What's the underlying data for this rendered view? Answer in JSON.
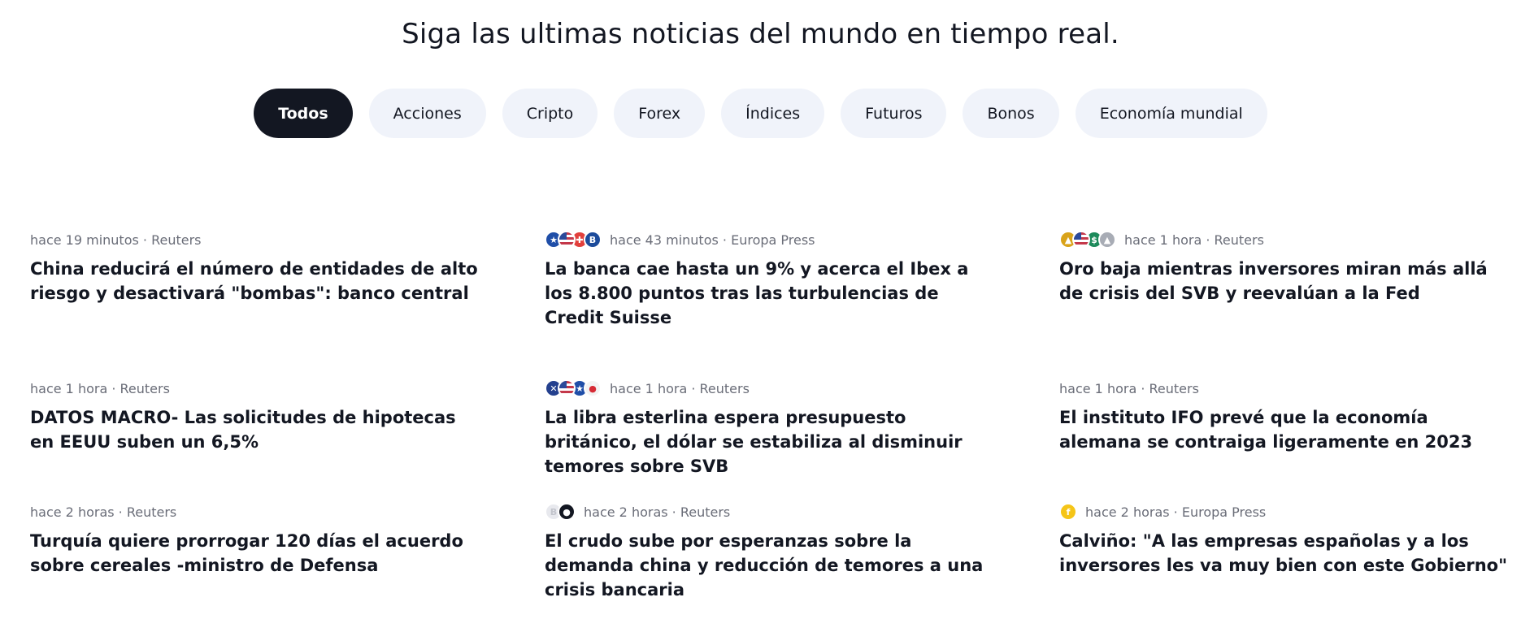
{
  "header": {
    "title": "Siga las ultimas noticias del mundo en tiempo real."
  },
  "tabs": [
    {
      "label": "Todos",
      "active": true
    },
    {
      "label": "Acciones"
    },
    {
      "label": "Cripto"
    },
    {
      "label": "Forex"
    },
    {
      "label": "Índices"
    },
    {
      "label": "Futuros"
    },
    {
      "label": "Bonos"
    },
    {
      "label": "Economía mundial"
    }
  ],
  "news": [
    {
      "meta": "hace 19 minutos · Reuters",
      "title": "China reducirá el número de entidades de alto riesgo y desactivará \"bombas\": banco central",
      "icons": []
    },
    {
      "meta": "hace 43 minutos · Europa Press",
      "title": "La banca cae hasta un 9% y acerca el Ibex a los 8.800 puntos tras las turbulencias de Credit Suisse",
      "icons": [
        {
          "name": "eu-flag-icon",
          "glyph": "★",
          "color": "#1f4ea8"
        },
        {
          "name": "us-flag-icon",
          "glyph": "",
          "color": "#c4384a"
        },
        {
          "name": "swiss-flag-icon",
          "glyph": "✚",
          "color": "#e2403c"
        },
        {
          "name": "bank-b-icon",
          "glyph": "B",
          "color": "#1c4b9b"
        }
      ]
    },
    {
      "meta": "hace 1 hora · Reuters",
      "title": "Oro baja mientras inversores miran más allá de crisis del SVB y reevalúan a la Fed",
      "icons": [
        {
          "name": "gold-icon",
          "glyph": "▲",
          "color": "#d9a31a"
        },
        {
          "name": "us-flag-icon",
          "glyph": "",
          "color": "#c4384a"
        },
        {
          "name": "dollar-icon",
          "glyph": "$",
          "color": "#1c8a5a"
        },
        {
          "name": "silver-icon",
          "glyph": "▲",
          "color": "#a8acb5"
        }
      ]
    },
    {
      "meta": "hace 1 hora · Reuters",
      "title": "DATOS MACRO- Las solicitudes de hipotecas en EEUU suben un 6,5%",
      "icons": []
    },
    {
      "meta": "hace 1 hora · Reuters",
      "title": "La libra esterlina espera presupuesto británico, el dólar se estabiliza al disminuir temores sobre SVB",
      "icons": [
        {
          "name": "uk-flag-icon",
          "glyph": "✕",
          "color": "#24408e"
        },
        {
          "name": "us-flag-icon",
          "glyph": "",
          "color": "#c4384a"
        },
        {
          "name": "eu-flag-icon",
          "glyph": "★",
          "color": "#1f4ea8"
        },
        {
          "name": "japan-flag-icon",
          "glyph": "●",
          "color": "#f3f3f3"
        }
      ]
    },
    {
      "meta": "hace 1 hora · Reuters",
      "title": "El instituto IFO prevé que la economía alemana se contraiga ligeramente en 2023",
      "icons": []
    },
    {
      "meta": "hace 2 horas · Reuters",
      "title": "Turquía quiere prorrogar 120 días el acuerdo sobre cereales -ministro de Defensa",
      "icons": []
    },
    {
      "meta": "hace 2 horas · Reuters",
      "title": "El crudo sube por esperanzas sobre la demanda china y reducción de temores a una crisis bancaria",
      "icons": [
        {
          "name": "brent-b-icon",
          "glyph": "B",
          "color": "#e8e9ee"
        },
        {
          "name": "oil-drop-icon",
          "glyph": "●",
          "color": "#131722"
        }
      ]
    },
    {
      "meta": "hace 2 horas · Europa Press",
      "title": "Calviño: \"A las empresas españolas y a los inversores les va muy bien con este Gobierno\"",
      "icons": [
        {
          "name": "coin-f-icon",
          "glyph": "f",
          "color": "#f5c518"
        }
      ]
    }
  ]
}
